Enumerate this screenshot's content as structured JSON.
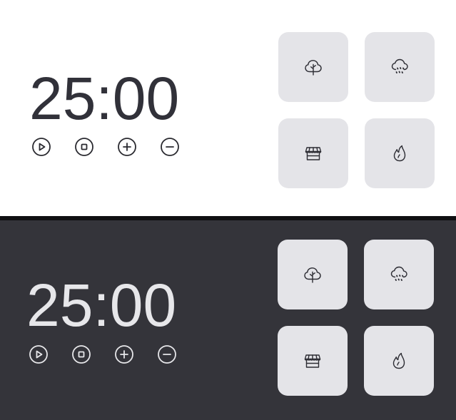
{
  "themes": {
    "light": {
      "timer": "25:00",
      "controls": [
        "play",
        "stop",
        "add",
        "subtract"
      ],
      "sounds": [
        "tree-icon",
        "rain-icon",
        "store-icon",
        "fire-icon"
      ],
      "colors": {
        "background": "#ffffff",
        "text": "#313139",
        "tile": "#e4e4e8"
      }
    },
    "dark": {
      "timer": "25:00",
      "controls": [
        "play",
        "stop",
        "add",
        "subtract"
      ],
      "sounds": [
        "tree-icon",
        "rain-icon",
        "store-icon",
        "fire-icon"
      ],
      "colors": {
        "background": "#34343a",
        "text": "#e7e7ea",
        "tile": "#e4e4e8"
      }
    }
  }
}
